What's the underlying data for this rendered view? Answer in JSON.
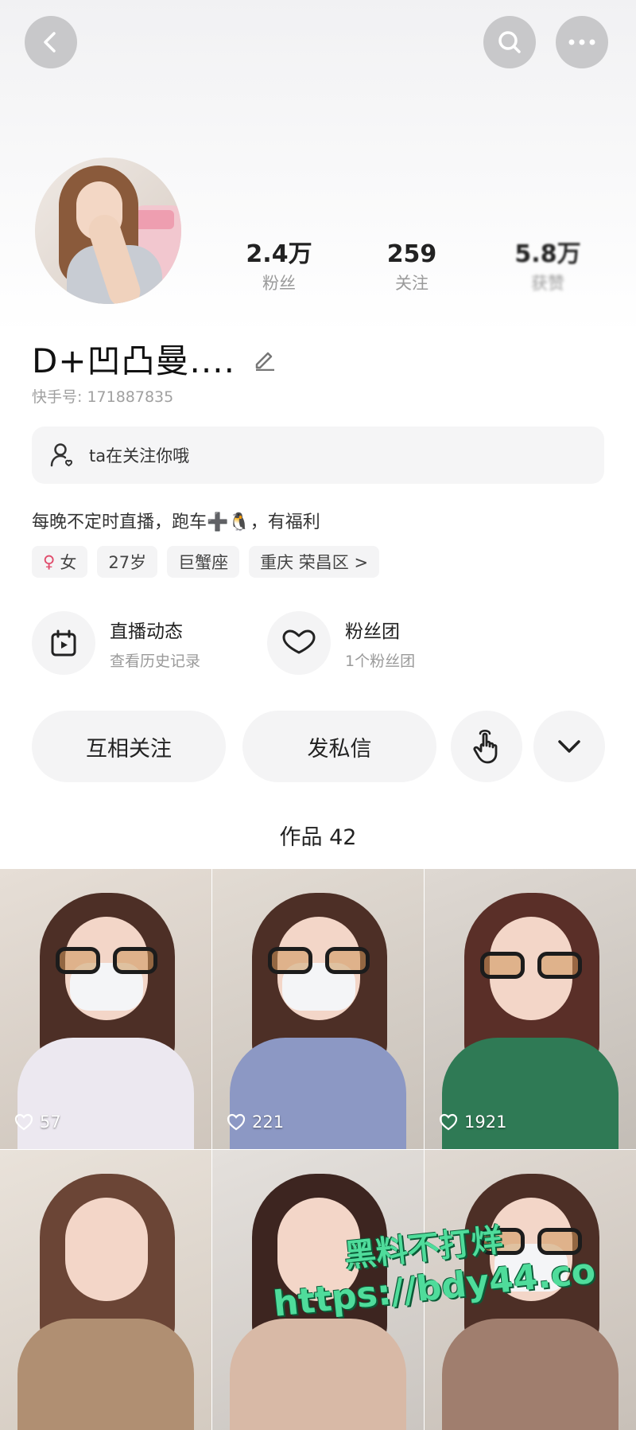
{
  "header": {
    "back_icon": "chevron-left-icon",
    "search_icon": "search-icon",
    "more_icon": "more-horizontal-icon"
  },
  "profile": {
    "stats": [
      {
        "value": "2.4万",
        "label": "粉丝"
      },
      {
        "value": "259",
        "label": "关注"
      },
      {
        "value": "5.8万",
        "label": "获赞"
      }
    ],
    "name": "D+凹凸曼....",
    "uid_text": "快手号: 171887835",
    "follow_hint": "ta在关注你哦",
    "bio": "每晚不定时直播，跑车➕🐧，有福利",
    "tags": [
      "女",
      "27岁",
      "巨蟹座",
      "重庆 荣昌区 >"
    ]
  },
  "features": {
    "live": {
      "title": "直播动态",
      "subtitle": "查看历史记录"
    },
    "fan": {
      "title": "粉丝团",
      "subtitle": "1个粉丝团"
    }
  },
  "actions": {
    "mutual": "互相关注",
    "message": "发私信"
  },
  "works": {
    "title": "作品 42",
    "items": [
      {
        "likes": "57"
      },
      {
        "likes": "221"
      },
      {
        "likes": "1921"
      },
      {
        "likes": ""
      },
      {
        "likes": ""
      },
      {
        "likes": ""
      }
    ]
  },
  "watermark": {
    "line1": "黑料不打烊",
    "line2": "https://bdy44.co"
  }
}
